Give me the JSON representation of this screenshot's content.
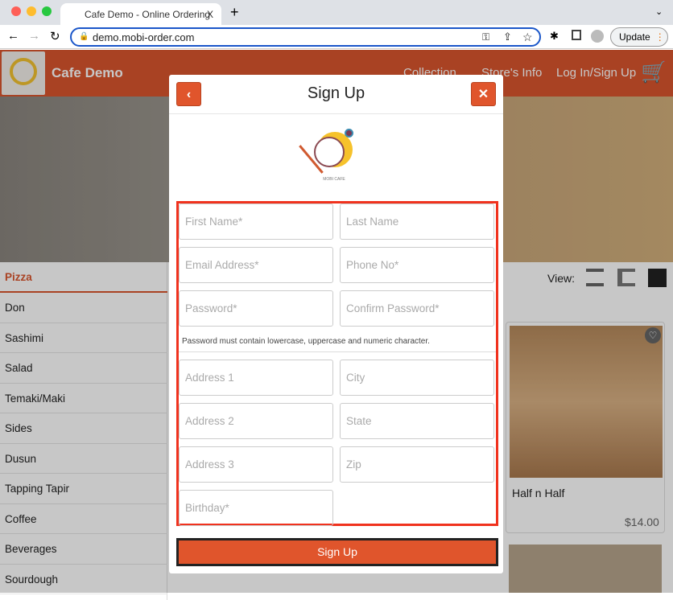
{
  "browser": {
    "tab_title": "Cafe Demo - Online Ordering",
    "tab_close": "X",
    "new_tab": "+",
    "url": "demo.mobi-order.com",
    "update_label": "Update"
  },
  "header": {
    "brand": "Cafe Demo",
    "nav": [
      "Collection",
      "Store's Info",
      "Log In/Sign Up"
    ],
    "color": "#d9552e"
  },
  "sidebar": {
    "active": "Pizza",
    "items": [
      "Don",
      "Sashimi",
      "Salad",
      "Temaki/Maki",
      "Sides",
      "Dusun",
      "Tapping Tapir",
      "Coffee",
      "Beverages",
      "Sourdough"
    ]
  },
  "view": {
    "label": "View:"
  },
  "product": {
    "name": "Half n Half",
    "price": "$14.00"
  },
  "modal": {
    "title": "Sign Up",
    "logo_text": "MOBI CAFE",
    "fields": [
      [
        "First Name*",
        "Last Name"
      ],
      [
        "Email Address*",
        "Phone No*"
      ],
      [
        "Password*",
        "Confirm Password*"
      ]
    ],
    "hint": "Password must contain lowercase, uppercase and numeric character.",
    "address_fields": [
      [
        "Address 1",
        "City"
      ],
      [
        "Address 2",
        "State"
      ],
      [
        "Address 3",
        "Zip"
      ],
      [
        "Birthday*",
        ""
      ]
    ],
    "submit": "Sign Up",
    "accent": "#e0552c"
  }
}
